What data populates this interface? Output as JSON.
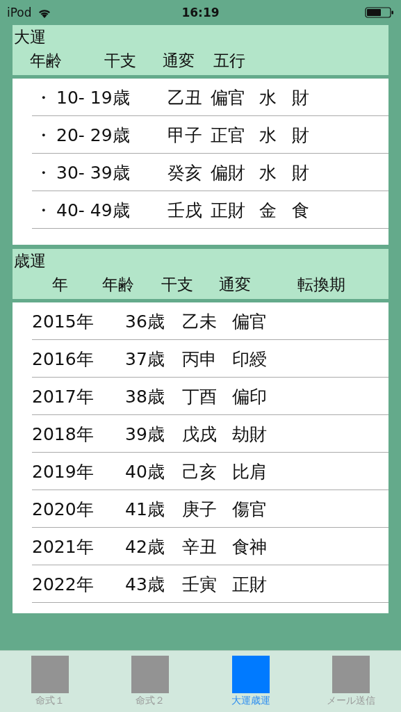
{
  "status_bar": {
    "carrier": "iPod",
    "time": "16:19"
  },
  "daiun": {
    "title": "大運",
    "columns": [
      "年齢",
      "干支",
      "通変",
      "五行"
    ],
    "rows": [
      {
        "bullet": "・",
        "age": "10- 19歳",
        "kanshi": "乙丑",
        "tsuhen": "偏官",
        "gogyo": "水",
        "column_5": "財"
      },
      {
        "bullet": "・",
        "age": "20- 29歳",
        "kanshi": "甲子",
        "tsuhen": "正官",
        "gogyo": "水",
        "column_5": "財"
      },
      {
        "bullet": "・",
        "age": "30- 39歳",
        "kanshi": "癸亥",
        "tsuhen": "偏財",
        "gogyo": "水",
        "column_5": "財"
      },
      {
        "bullet": "・",
        "age": "40- 49歳",
        "kanshi": "壬戌",
        "tsuhen": "正財",
        "gogyo": "金",
        "column_5": "食"
      }
    ]
  },
  "saiun": {
    "title": "歳運",
    "columns": [
      "年",
      "年齢",
      "干支",
      "通変",
      "転換期"
    ],
    "rows": [
      {
        "year": "2015年",
        "age": "36歳",
        "kanshi": "乙未",
        "tsuhen": "偏官"
      },
      {
        "year": "2016年",
        "age": "37歳",
        "kanshi": "丙申",
        "tsuhen": "印綬"
      },
      {
        "year": "2017年",
        "age": "38歳",
        "kanshi": "丁酉",
        "tsuhen": "偏印"
      },
      {
        "year": "2018年",
        "age": "39歳",
        "kanshi": "戊戌",
        "tsuhen": "劫財"
      },
      {
        "year": "2019年",
        "age": "40歳",
        "kanshi": "己亥",
        "tsuhen": "比肩"
      },
      {
        "year": "2020年",
        "age": "41歳",
        "kanshi": "庚子",
        "tsuhen": "傷官"
      },
      {
        "year": "2021年",
        "age": "42歳",
        "kanshi": "辛丑",
        "tsuhen": "食神"
      },
      {
        "year": "2022年",
        "age": "43歳",
        "kanshi": "壬寅",
        "tsuhen": "正財"
      }
    ]
  },
  "tabs": [
    {
      "label": "命式１",
      "selected": false
    },
    {
      "label": "命式２",
      "selected": false
    },
    {
      "label": "大運歳運",
      "selected": true
    },
    {
      "label": "メール送信",
      "selected": false
    }
  ]
}
